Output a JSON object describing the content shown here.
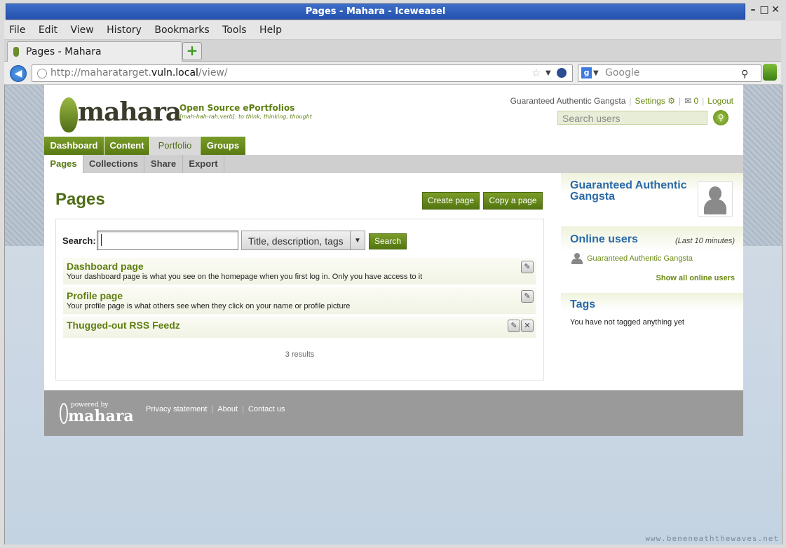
{
  "window": {
    "title": "Pages - Mahara - Iceweasel"
  },
  "menu": [
    "File",
    "Edit",
    "View",
    "History",
    "Bookmarks",
    "Tools",
    "Help"
  ],
  "tab": {
    "label": "Pages - Mahara"
  },
  "address": {
    "url_prefix": "http://maharatarget.",
    "url_domain": "vuln.local",
    "url_path": "/view/"
  },
  "websearch": {
    "placeholder": "Google"
  },
  "site": {
    "logo": "mahara",
    "tagline": "Open Source ePortfolios",
    "subtagline": "[mah-hah-rah;verb]: to think, thinking, thought"
  },
  "header": {
    "user": "Guaranteed Authentic Gangsta",
    "settings": "Settings",
    "messages": "0",
    "logout": "Logout",
    "search_placeholder": "Search users"
  },
  "mainnav": [
    "Dashboard",
    "Content",
    "Portfolio",
    "Groups"
  ],
  "subnav": [
    "Pages",
    "Collections",
    "Share",
    "Export"
  ],
  "main": {
    "title": "Pages",
    "create_btn": "Create page",
    "copy_btn": "Copy a page",
    "search_label": "Search:",
    "search_value": "",
    "search_scope": "Title, description, tags",
    "search_btn": "Search",
    "items": [
      {
        "title": "Dashboard page",
        "desc": "Your dashboard page is what you see on the homepage when you first log in. Only you have access to it"
      },
      {
        "title": "Profile page",
        "desc": "Your profile page is what others see when they click on your name or profile picture"
      },
      {
        "title": "Thugged-out RSS Feedz",
        "desc": ""
      }
    ],
    "results": "3 results"
  },
  "sidebar": {
    "profile_name": "Guaranteed Authentic Gangsta",
    "online_title": "Online users",
    "online_note": "(Last 10 minutes)",
    "online_user": "Guaranteed Authentic Gangsta",
    "online_all": "Show all online users",
    "tags_title": "Tags",
    "tags_text": "You have not tagged anything yet"
  },
  "footer": {
    "powered": "powered by",
    "logo": "mahara",
    "links": [
      "Privacy statement",
      "About",
      "Contact us"
    ]
  },
  "watermark": "www.beneneaththewaves.net"
}
